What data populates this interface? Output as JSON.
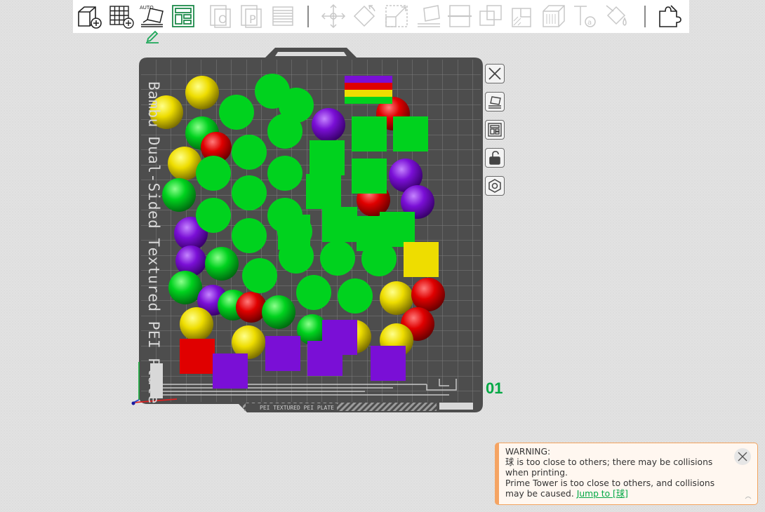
{
  "toolbar": {
    "buttons": [
      {
        "name": "add-object",
        "icon": "cube-plus-icon",
        "enabled": true
      },
      {
        "name": "add-plate",
        "icon": "grid-plus-icon",
        "enabled": true
      },
      {
        "name": "auto-orient",
        "icon": "auto-orient-icon",
        "label": "AUTO",
        "enabled": true
      },
      {
        "name": "arrange",
        "icon": "arrange-icon",
        "enabled": true
      },
      {
        "name": "split-objects",
        "icon": "split-objects-icon",
        "enabled": false
      },
      {
        "name": "split-parts",
        "icon": "split-parts-icon",
        "enabled": false
      },
      {
        "name": "layers",
        "icon": "layers-icon",
        "enabled": false
      },
      {
        "name": "move",
        "icon": "move-icon",
        "enabled": false
      },
      {
        "name": "rotate",
        "icon": "rotate-icon",
        "enabled": false
      },
      {
        "name": "scale",
        "icon": "scale-icon",
        "enabled": false
      },
      {
        "name": "lay-on-face",
        "icon": "lay-on-face-icon",
        "enabled": false
      },
      {
        "name": "cut",
        "icon": "cut-icon",
        "enabled": false
      },
      {
        "name": "boolean",
        "icon": "boolean-icon",
        "enabled": false
      },
      {
        "name": "support-paint",
        "icon": "support-paint-icon",
        "enabled": false
      },
      {
        "name": "seam-paint",
        "icon": "seam-paint-icon",
        "enabled": false
      },
      {
        "name": "text",
        "icon": "text-icon",
        "enabled": false
      },
      {
        "name": "color-paint",
        "icon": "color-paint-icon",
        "enabled": false
      },
      {
        "name": "assembly",
        "icon": "assembly-icon",
        "enabled": true
      }
    ]
  },
  "plate": {
    "label": "Bambu Dual-Sided Textured PEI Plate",
    "number": "01",
    "bottom_label": "PEI TEXTURED PEI PLATE",
    "side_buttons": [
      {
        "name": "close-plate-button",
        "icon": "close-icon"
      },
      {
        "name": "orient-plate-button",
        "icon": "auto-orient-icon"
      },
      {
        "name": "arrange-plate-button",
        "icon": "arrange-icon"
      },
      {
        "name": "lock-plate-button",
        "icon": "unlock-icon"
      },
      {
        "name": "plate-settings-button",
        "icon": "settings-hex-icon"
      }
    ]
  },
  "scene": {
    "colors": {
      "green": "#00d21e",
      "yellow": "#eedd00",
      "red": "#e00000",
      "purple": "#7a0fd6"
    },
    "tower_stripes": [
      "#7a0fd6",
      "#e00000",
      "#eedd00",
      "#00d21e"
    ],
    "accent": "#00a844"
  },
  "notification": {
    "title": "WARNING:",
    "line1": "球 is too close to others; there may be collisions when printing.",
    "line2": "Prime Tower is too close to others, and collisions may be caused.",
    "link": "Jump to [球]"
  }
}
